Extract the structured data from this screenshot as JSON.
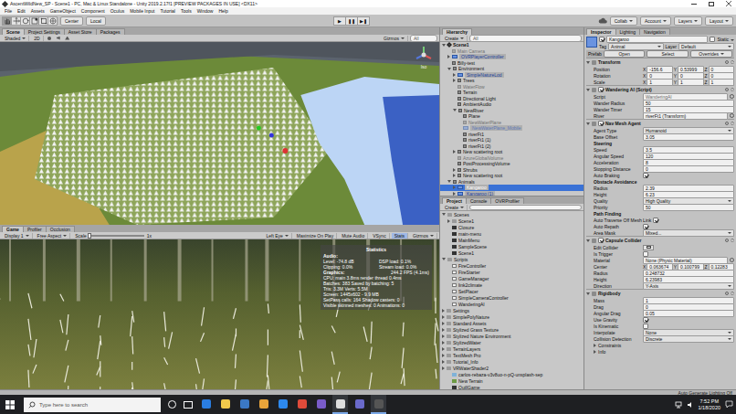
{
  "window": {
    "title": "AscentWildNew_SP - Scene1 - PC, Mac & Linux Standalone - Unity 2019.2.17f1 [PREVIEW PACKAGES IN USE] <DX11>"
  },
  "menu": [
    "File",
    "Edit",
    "Assets",
    "GameObject",
    "Component",
    "Oculus",
    "Mobile Input",
    "Tutorial",
    "Tools",
    "Window",
    "Help"
  ],
  "toolbar": {
    "tools": [
      {
        "selected": true
      },
      {
        "selected": false
      },
      {
        "selected": false
      },
      {
        "selected": false
      },
      {
        "selected": false
      },
      {
        "selected": false
      }
    ],
    "pivot": "Center",
    "space": "Local",
    "play": [
      {
        "label": "▶",
        "on": false
      },
      {
        "label": "❚❚",
        "on": false
      },
      {
        "label": "▶❚",
        "on": false
      }
    ],
    "right": [
      "Collab",
      "Account",
      "Layers",
      "Layout"
    ]
  },
  "scene": {
    "tabs": [
      {
        "label": "Scene",
        "selected": true
      },
      {
        "label": "Project Settings",
        "selected": false
      },
      {
        "label": "Asset Store",
        "selected": false
      },
      {
        "label": "Packages",
        "selected": false
      }
    ],
    "shading": "Shaded",
    "mode2d": {
      "label": "2D",
      "on": false
    },
    "gizmos": "Gizmos",
    "search": "All",
    "gizmo_label": "Iso"
  },
  "game": {
    "tabs": [
      {
        "label": "Game",
        "selected": true
      },
      {
        "label": "Profiler",
        "selected": false
      },
      {
        "label": "Occlusion",
        "selected": false
      }
    ],
    "toolbar": [
      {
        "label": "Display 1",
        "kind": "dropdown",
        "on": false
      },
      {
        "label": "Free Aspect",
        "kind": "dropdown",
        "on": false
      },
      {
        "label": "Scale",
        "kind": "slider",
        "on": false,
        "level": 0.0,
        "value": "1x"
      },
      {
        "label": "Left Eye",
        "kind": "dropdown",
        "on": false
      },
      {
        "label": "Maximize On Play",
        "kind": "toggle",
        "on": false
      },
      {
        "label": "Mute Audio",
        "kind": "toggle",
        "on": false
      },
      {
        "label": "VSync",
        "kind": "toggle",
        "on": false
      },
      {
        "label": "Stats",
        "kind": "toggle",
        "on": true
      },
      {
        "label": "Gizmos",
        "kind": "dropdown",
        "on": false
      }
    ],
    "stats": {
      "title": "Statistics",
      "audio_heading": "Audio:",
      "audio": [
        [
          "Level: -74.8 dB",
          "DSP load: 0.1%"
        ],
        [
          "Clipping: 0.0%",
          "Stream load: 0.0%"
        ]
      ],
      "graphics_heading": "Graphics:",
      "fps": "244.2 FPS (4.1ms)",
      "graphics": [
        "CPU: main 3.8ms  render thread 0.4ms",
        "Batches: 383   Saved by batching: 5",
        "Tris: 3.3M   Verts: 5.5M",
        "Screen: 1445x602 - 9.9 MB",
        "SetPass calls: 164   Shadow casters: 0",
        "Visible skinned meshes: 0  Animations: 0"
      ]
    }
  },
  "hierarchy": {
    "tabs": [
      {
        "label": "Hierarchy",
        "selected": true
      }
    ],
    "create": "Create",
    "search": "All",
    "items": [
      {
        "label": "Scene1",
        "depth": 0,
        "expanded": true,
        "kind": "scene",
        "active": true,
        "selected": false
      },
      {
        "label": "Main Camera",
        "depth": 1,
        "expanded": null,
        "kind": "object",
        "active": false,
        "selected": false
      },
      {
        "label": "OVRPlayerController",
        "depth": 1,
        "expanded": false,
        "kind": "prefab",
        "active": true,
        "selected": false
      },
      {
        "label": "Billy-test",
        "depth": 1,
        "expanded": null,
        "kind": "object",
        "active": true,
        "selected": false
      },
      {
        "label": "Environment",
        "depth": 1,
        "expanded": true,
        "kind": "object",
        "active": true,
        "selected": false
      },
      {
        "label": "SimpleNatureLod",
        "depth": 2,
        "expanded": false,
        "kind": "prefab",
        "active": true,
        "selected": false
      },
      {
        "label": "Trees",
        "depth": 2,
        "expanded": false,
        "kind": "object",
        "active": true,
        "selected": false
      },
      {
        "label": "WaterFlow",
        "depth": 2,
        "expanded": null,
        "kind": "object",
        "active": false,
        "selected": false
      },
      {
        "label": "Terrain",
        "depth": 2,
        "expanded": null,
        "kind": "object",
        "active": true,
        "selected": false
      },
      {
        "label": "Directional Light",
        "depth": 2,
        "expanded": null,
        "kind": "object",
        "active": true,
        "selected": false
      },
      {
        "label": "AmbientAudio",
        "depth": 2,
        "expanded": null,
        "kind": "object",
        "active": true,
        "selected": false
      },
      {
        "label": "NewRiver",
        "depth": 2,
        "expanded": true,
        "kind": "object",
        "active": true,
        "selected": false
      },
      {
        "label": "Plane",
        "depth": 3,
        "expanded": null,
        "kind": "object",
        "active": true,
        "selected": false
      },
      {
        "label": "NewWaterPlane",
        "depth": 3,
        "expanded": null,
        "kind": "object",
        "active": false,
        "selected": false
      },
      {
        "label": "NewWaterPlane_Mobile",
        "depth": 3,
        "expanded": null,
        "kind": "prefab",
        "active": false,
        "selected": false
      },
      {
        "label": "riverFt1",
        "depth": 3,
        "expanded": null,
        "kind": "object",
        "active": true,
        "selected": false
      },
      {
        "label": "riverFt1 (1)",
        "depth": 3,
        "expanded": null,
        "kind": "object",
        "active": true,
        "selected": false
      },
      {
        "label": "riverFt1 (2)",
        "depth": 3,
        "expanded": null,
        "kind": "object",
        "active": true,
        "selected": false
      },
      {
        "label": "New scattering root",
        "depth": 2,
        "expanded": false,
        "kind": "object",
        "active": true,
        "selected": false
      },
      {
        "label": "AzureGlobalVolume",
        "depth": 2,
        "expanded": null,
        "kind": "object",
        "active": false,
        "selected": false
      },
      {
        "label": "PostProcessingVolume",
        "depth": 2,
        "expanded": null,
        "kind": "object",
        "active": true,
        "selected": false
      },
      {
        "label": "Shrubs",
        "depth": 2,
        "expanded": false,
        "kind": "object",
        "active": true,
        "selected": false
      },
      {
        "label": "New scattering root",
        "depth": 2,
        "expanded": false,
        "kind": "object",
        "active": true,
        "selected": false
      },
      {
        "label": "Animals",
        "depth": 1,
        "expanded": true,
        "kind": "object",
        "active": true,
        "selected": false
      },
      {
        "label": "Kangaroo",
        "depth": 2,
        "expanded": false,
        "kind": "prefab",
        "active": true,
        "selected": true
      },
      {
        "label": "Kangaroo (1)",
        "depth": 2,
        "expanded": false,
        "kind": "prefab",
        "active": true,
        "selected": false
      }
    ]
  },
  "project": {
    "tabs": [
      {
        "label": "Project",
        "selected": true
      },
      {
        "label": "Console",
        "selected": false
      },
      {
        "label": "OVRProfiler",
        "selected": false
      }
    ],
    "create": "Create",
    "items": [
      {
        "label": "Scenes",
        "depth": 0,
        "kind": "folder",
        "expanded": true
      },
      {
        "label": "Scene1",
        "depth": 1,
        "kind": "folder",
        "expanded": false
      },
      {
        "label": "Closure",
        "depth": 1,
        "kind": "scene",
        "expanded": null
      },
      {
        "label": "main-menu",
        "depth": 1,
        "kind": "scene",
        "expanded": null
      },
      {
        "label": "MainMenu",
        "depth": 1,
        "kind": "scene",
        "expanded": null
      },
      {
        "label": "SampleScene",
        "depth": 1,
        "kind": "scene",
        "expanded": null
      },
      {
        "label": "Scene1",
        "depth": 1,
        "kind": "scene",
        "expanded": null
      },
      {
        "label": "Scripts",
        "depth": 0,
        "kind": "folder",
        "expanded": true
      },
      {
        "label": "FireController",
        "depth": 1,
        "kind": "script",
        "expanded": null
      },
      {
        "label": "FireStarter",
        "depth": 1,
        "kind": "script",
        "expanded": null
      },
      {
        "label": "GameManager",
        "depth": 1,
        "kind": "script",
        "expanded": null
      },
      {
        "label": "link2climate",
        "depth": 1,
        "kind": "script",
        "expanded": null
      },
      {
        "label": "SetPlacer",
        "depth": 1,
        "kind": "script",
        "expanded": null
      },
      {
        "label": "SimpleCameraController",
        "depth": 1,
        "kind": "script",
        "expanded": null
      },
      {
        "label": "WanderingAI",
        "depth": 1,
        "kind": "script",
        "expanded": null
      },
      {
        "label": "Settings",
        "depth": 0,
        "kind": "folder",
        "expanded": false
      },
      {
        "label": "SimplePolyNature",
        "depth": 0,
        "kind": "folder",
        "expanded": false
      },
      {
        "label": "Standard Assets",
        "depth": 0,
        "kind": "folder",
        "expanded": false
      },
      {
        "label": "Stylized Grass Texture",
        "depth": 0,
        "kind": "folder",
        "expanded": false
      },
      {
        "label": "Stylized Nature Environment",
        "depth": 0,
        "kind": "folder",
        "expanded": false
      },
      {
        "label": "StylizedWater",
        "depth": 0,
        "kind": "folder",
        "expanded": false
      },
      {
        "label": "TerrainLayers",
        "depth": 0,
        "kind": "folder",
        "expanded": false
      },
      {
        "label": "TextMesh Pro",
        "depth": 0,
        "kind": "folder",
        "expanded": false
      },
      {
        "label": "Tutorial_Info",
        "depth": 0,
        "kind": "folder",
        "expanded": false
      },
      {
        "label": "VRWaterShader2",
        "depth": 0,
        "kind": "folder",
        "expanded": false
      },
      {
        "label": "carlos-rebaza-v3v8uo-n-pQ-unsplash-sep",
        "depth": 1,
        "kind": "image",
        "expanded": null
      },
      {
        "label": "New Terrain",
        "depth": 1,
        "kind": "terrain",
        "expanded": null
      },
      {
        "label": "QuillGame",
        "depth": 1,
        "kind": "scene",
        "expanded": null
      }
    ]
  },
  "inspector": {
    "tabs": [
      {
        "label": "Inspector",
        "selected": true
      },
      {
        "label": "Lighting",
        "selected": false
      },
      {
        "label": "Navigation",
        "selected": false
      }
    ],
    "object": {
      "name": "Kangaroo",
      "active": true,
      "static": {
        "label": "Static",
        "checked": false
      },
      "tag": {
        "label": "Tag",
        "value": "Animal"
      },
      "layer": {
        "label": "Layer",
        "value": "Default"
      },
      "prefab": {
        "label": "Prefab",
        "buttons": [
          "Open",
          "Select",
          "Overrides"
        ]
      }
    },
    "components": [
      {
        "title": "Transform",
        "toggle": false,
        "enabled": true,
        "rows": [
          {
            "kind": "vec3",
            "label": "Position",
            "values": [
              {
                "axis": "X",
                "value": "-156.6"
              },
              {
                "axis": "Y",
                "value": "0.53999"
              },
              {
                "axis": "Z",
                "value": "0"
              }
            ]
          },
          {
            "kind": "vec3",
            "label": "Rotation",
            "values": [
              {
                "axis": "X",
                "value": "0"
              },
              {
                "axis": "Y",
                "value": "0"
              },
              {
                "axis": "Z",
                "value": "0"
              }
            ]
          },
          {
            "kind": "vec3",
            "label": "Scale",
            "values": [
              {
                "axis": "X",
                "value": "1"
              },
              {
                "axis": "Y",
                "value": "1"
              },
              {
                "axis": "Z",
                "value": "1"
              }
            ]
          }
        ]
      },
      {
        "title": "Wandering AI (Script)",
        "toggle": true,
        "enabled": true,
        "rows": [
          {
            "kind": "object",
            "label": "Script",
            "value": "WanderingAI",
            "disabled": true
          },
          {
            "kind": "field",
            "label": "Wander Radius",
            "value": "50"
          },
          {
            "kind": "field",
            "label": "Wander Timer",
            "value": "15"
          },
          {
            "kind": "object",
            "label": "River",
            "value": "riverFt1 (Transform)",
            "disabled": false
          }
        ]
      },
      {
        "title": "Nav Mesh Agent",
        "toggle": true,
        "enabled": true,
        "rows": [
          {
            "kind": "dropdown",
            "label": "Agent Type",
            "value": "Humanoid"
          },
          {
            "kind": "field",
            "label": "Base Offset",
            "value": "3.05"
          },
          {
            "kind": "section",
            "label": "Steering"
          },
          {
            "kind": "field",
            "label": "Speed",
            "value": "3.5"
          },
          {
            "kind": "field",
            "label": "Angular Speed",
            "value": "120"
          },
          {
            "kind": "field",
            "label": "Acceleration",
            "value": "8"
          },
          {
            "kind": "field",
            "label": "Stopping Distance",
            "value": "0"
          },
          {
            "kind": "check",
            "label": "Auto Braking",
            "checked": true
          },
          {
            "kind": "section",
            "label": "Obstacle Avoidance"
          },
          {
            "kind": "field",
            "label": "Radius",
            "value": "2.39"
          },
          {
            "kind": "field",
            "label": "Height",
            "value": "6.23"
          },
          {
            "kind": "dropdown",
            "label": "Quality",
            "value": "High Quality"
          },
          {
            "kind": "field",
            "label": "Priority",
            "value": "50"
          },
          {
            "kind": "section",
            "label": "Path Finding"
          },
          {
            "kind": "check",
            "label": "Auto Traverse Off Mesh Link",
            "checked": true
          },
          {
            "kind": "check",
            "label": "Auto Repath",
            "checked": true
          },
          {
            "kind": "dropdown",
            "label": "Area Mask",
            "value": "Mixed..."
          }
        ]
      },
      {
        "title": "Capsule Collider",
        "toggle": true,
        "enabled": true,
        "rows": [
          {
            "kind": "button",
            "label": "Edit Collider"
          },
          {
            "kind": "check",
            "label": "Is Trigger",
            "checked": false
          },
          {
            "kind": "object",
            "label": "Material",
            "value": "None (Physic Material)",
            "disabled": false
          },
          {
            "kind": "vec3",
            "label": "Center",
            "values": [
              {
                "axis": "X",
                "value": "0.063674"
              },
              {
                "axis": "Y",
                "value": "0.100799"
              },
              {
                "axis": "Z",
                "value": "0.12283"
              }
            ]
          },
          {
            "kind": "field",
            "label": "Radius",
            "value": "0.248732"
          },
          {
            "kind": "field",
            "label": "Height",
            "value": "6.23983"
          },
          {
            "kind": "dropdown",
            "label": "Direction",
            "value": "Y-Axis"
          }
        ]
      },
      {
        "title": "Rigidbody",
        "toggle": false,
        "enabled": true,
        "rows": [
          {
            "kind": "field",
            "label": "Mass",
            "value": "1"
          },
          {
            "kind": "field",
            "label": "Drag",
            "value": "0"
          },
          {
            "kind": "field",
            "label": "Angular Drag",
            "value": "0.05"
          },
          {
            "kind": "check",
            "label": "Use Gravity",
            "checked": true
          },
          {
            "kind": "check",
            "label": "Is Kinematic",
            "checked": false
          },
          {
            "kind": "dropdown",
            "label": "Interpolate",
            "value": "None"
          },
          {
            "kind": "dropdown",
            "label": "Collision Detection",
            "value": "Discrete"
          },
          {
            "kind": "fold",
            "label": "Constraints"
          },
          {
            "kind": "fold",
            "label": "Info"
          }
        ]
      }
    ]
  },
  "status_bar": {
    "text": "Auto Generate Lighting Off"
  },
  "taskbar": {
    "search": "Type here to search",
    "apps": [
      {
        "color": "#2a7de1",
        "open": false
      },
      {
        "color": "#f2c94c",
        "open": false
      },
      {
        "color": "#3b78c4",
        "open": false
      },
      {
        "color": "#e8a43a",
        "open": false
      },
      {
        "color": "#2d89ef",
        "open": false
      },
      {
        "color": "#e04b3a",
        "open": false
      },
      {
        "color": "#7a5cc9",
        "open": false
      },
      {
        "color": "#dddddd",
        "open": true
      },
      {
        "color": "#6a6acb",
        "open": false
      },
      {
        "color": "#555555",
        "open": true
      }
    ],
    "time": "7:52 PM",
    "date": "1/18/2020"
  }
}
